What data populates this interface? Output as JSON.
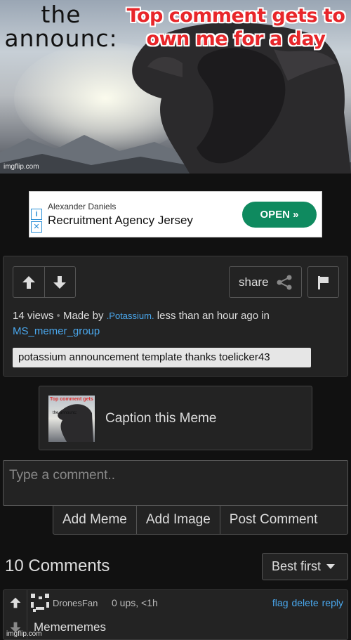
{
  "meme": {
    "announce_text": "the announc:",
    "top_text": "Top comment gets to own me for a day",
    "watermark": "imgflip.com"
  },
  "ad": {
    "advertiser": "Alexander Daniels",
    "title": "Recruitment Agency Jersey",
    "open_label": "OPEN »",
    "info_icon": "i",
    "close_icon": "✕"
  },
  "post": {
    "views": "14 views",
    "separator": "•",
    "made_by": "Made by",
    "user": ".Potassium.",
    "time_in": "less than an hour ago in",
    "stream": "MS_memer_group",
    "title": "potassium announcement template thanks toelicker43",
    "share_label": "share"
  },
  "caption": {
    "label": "Caption this Meme",
    "thumb_text_top": "Top comment gets",
    "thumb_text_side": "the announc:"
  },
  "comment_form": {
    "placeholder": "Type a comment..",
    "buttons": [
      "Add Meme",
      "Add Image",
      "Post Comment"
    ]
  },
  "comments_header": {
    "count": "10 Comments",
    "sort": "Best first"
  },
  "comments": [
    {
      "author": "DronesFan",
      "stats": "0 ups, <1h",
      "actions": [
        "flag",
        "delete",
        "reply"
      ],
      "text": "Memememes",
      "watermark": "imgflip.com"
    }
  ],
  "colors": {
    "background": "#111111",
    "panel": "#232323",
    "link": "#4aa8ee",
    "meme_red": "#e8262a",
    "ad_green": "#0f8a5f"
  }
}
